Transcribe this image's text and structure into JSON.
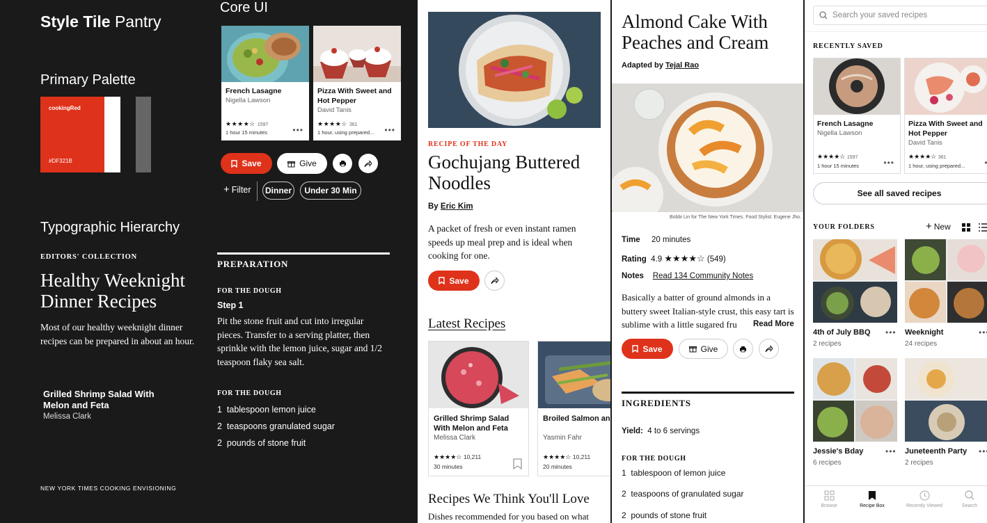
{
  "tile": {
    "brand_bold": "Style Tile",
    "brand_light": "Pantry",
    "palette_heading": "Primary Palette",
    "swatch_name": "cookingRed",
    "swatch_hex": "#DF321B",
    "typo_heading": "Typographic Hierarchy",
    "kicker": "EDITORS' COLLECTION",
    "headline": "Healthy Weeknight Dinner Recipes",
    "body": "Most of our healthy weeknight dinner recipes can be prepared in about an hour.",
    "card_title": "Grilled Shrimp Salad With Melon and Feta",
    "card_author": "Melissa Clark",
    "footer": "NEW YORK TIMES COOKING ENVISIONING"
  },
  "core": {
    "title": "Core UI",
    "cards": [
      {
        "title": "French Lasagne",
        "author": "Nigella Lawson",
        "stars": "★★★★☆",
        "count": "1597",
        "time": "1 hour 15 minutes"
      },
      {
        "title": "Pizza With Sweet and Hot Pepper",
        "author": "David Tanis",
        "stars": "★★★★☆",
        "count": "361",
        "time": "1 hour, using prepared..."
      }
    ],
    "save": "Save",
    "give": "Give",
    "filter": "Filter",
    "chips": [
      "Dinner",
      "Under 30 Min"
    ],
    "prep_heading": "PREPARATION",
    "dough1": "FOR THE DOUGH",
    "step": "Step 1",
    "step_text": "Pit the stone fruit and cut into irregular pieces. Transfer to a serving platter, then sprinkle with the lemon juice, sugar and 1/2 teaspoon flaky sea salt.",
    "dough2": "FOR THE DOUGH",
    "ingredients": [
      {
        "qty": "1",
        "text": "tablespoon lemon juice"
      },
      {
        "qty": "2",
        "text": "teaspoons granulated sugar"
      },
      {
        "qty": "2",
        "text": "pounds of stone fruit"
      }
    ]
  },
  "home": {
    "kicker": "RECIPE OF THE DAY",
    "title": "Gochujang Buttered Noodles",
    "by": "By",
    "author": "Eric Kim",
    "desc": "A packet of fresh or even instant ramen speeds up meal prep and is ideal when cooking for one.",
    "save": "Save",
    "latest": "Latest Recipes",
    "cards": [
      {
        "title": "Grilled Shrimp Salad With Melon and Feta",
        "author": "Melissa Clark",
        "stars": "★★★★☆",
        "count": "10,211",
        "time": "30 minutes"
      },
      {
        "title": "Broiled Salmon and Asparagus With Herbs",
        "author": "Yasmin Fahr",
        "stars": "★★★★☆",
        "count": "10,211",
        "time": "20 minutes"
      }
    ],
    "love": "Recipes We Think You'll Love",
    "love_sub": "Dishes recommended for you based on what"
  },
  "recipe": {
    "title": "Almond Cake With Peaches and Cream",
    "adapted": "Adapted by",
    "author": "Tejal Rao",
    "credit": "Bobbi Lin for The New York Times. Food Stylist: Eugene Jho.",
    "time_label": "Time",
    "time_value": "20 minutes",
    "rating_label": "Rating",
    "rating_value": "4.9",
    "rating_stars": "★★★★☆",
    "rating_count": "(549)",
    "notes_label": "Notes",
    "notes_value": "Read 134 Community Notes",
    "desc": "Basically a batter of ground almonds in a buttery sweet Italian-style crust, this easy tart is sublime with a little sugared fru",
    "read_more": "Read More",
    "save": "Save",
    "give": "Give",
    "ing_heading": "INGREDIENTS",
    "yield_label": "Yield:",
    "yield_value": "4 to 6 servings",
    "dough": "FOR THE DOUGH",
    "ingredients": [
      {
        "qty": "1",
        "text": "tablespoon of lemon juice"
      },
      {
        "qty": "2",
        "text": "teaspoons of granulated sugar"
      },
      {
        "qty": "2",
        "text": "pounds of stone fruit"
      }
    ]
  },
  "box": {
    "search_placeholder": "Search your saved recipes",
    "recent_heading": "RECENTLY SAVED",
    "cards": [
      {
        "title": "French Lasagne",
        "author": "Nigella Lawson",
        "stars": "★★★★☆",
        "count": "1597",
        "time": "1 hour 15 minutes"
      },
      {
        "title": "Pizza With Sweet and Hot Pepper",
        "author": "David Tanis",
        "stars": "★★★★☆",
        "count": "361",
        "time": "1 hour, using prepared..."
      }
    ],
    "see_all": "See all saved recipes",
    "folders_heading": "YOUR FOLDERS",
    "new": "New",
    "folders": [
      {
        "name": "4th of July BBQ",
        "count": "2 recipes"
      },
      {
        "name": "Weeknight",
        "count": "24 recipes"
      },
      {
        "name": "Jessie's Bday",
        "count": "6 recipes"
      },
      {
        "name": "Juneteenth Party",
        "count": "2 recipes"
      }
    ],
    "nav": [
      {
        "label": "Browse"
      },
      {
        "label": "Recipe Box"
      },
      {
        "label": "Recently Viewed"
      },
      {
        "label": "Search"
      }
    ]
  },
  "colors": {
    "accent": "#DF321B",
    "dark": "#1A1A1A",
    "gray": "#666666"
  }
}
